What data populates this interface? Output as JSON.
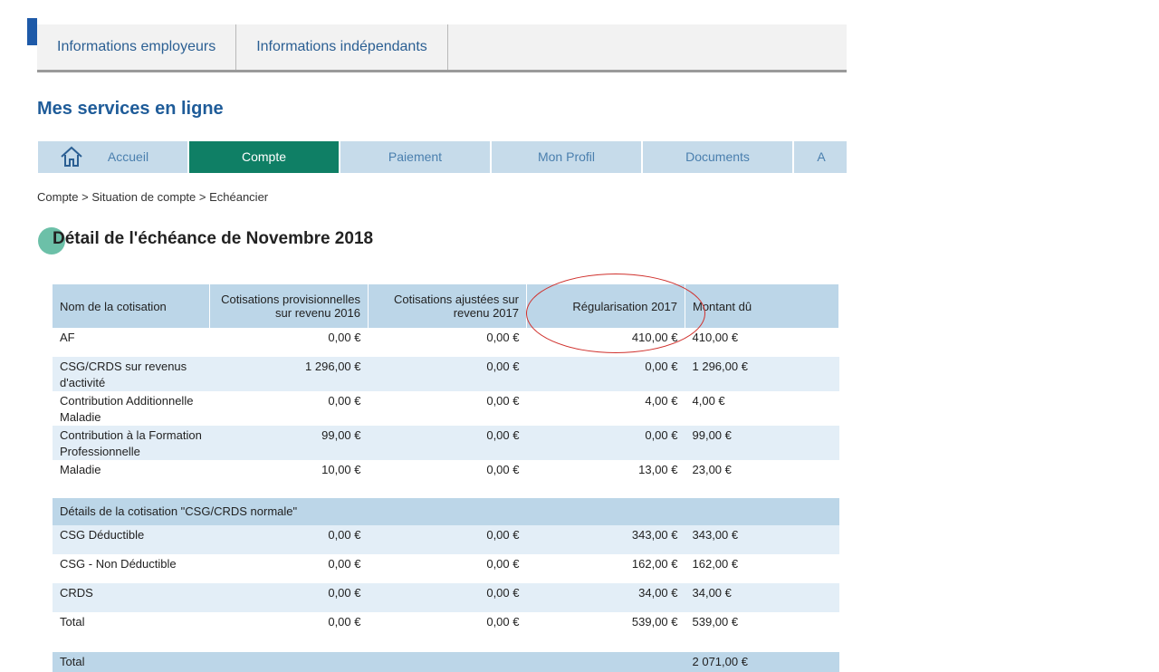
{
  "top_tabs": [
    "Informations employeurs",
    "Informations indépendants"
  ],
  "heading": "Mes services en ligne",
  "nav": {
    "items": [
      "Accueil",
      "Compte",
      "Paiement",
      "Mon Profil",
      "Documents",
      "A"
    ],
    "active": "Compte",
    "home_icon": "home-icon"
  },
  "breadcrumb": {
    "parts": [
      "Compte",
      "Situation de compte",
      "Echéancier"
    ],
    "separator": " > "
  },
  "section_title": "Détail de l'échéance de Novembre 2018",
  "table": {
    "headers": [
      "Nom de la cotisation",
      "Cotisations provisionnelles sur revenu 2016",
      "Cotisations ajustées sur revenu 2017",
      "Régularisation 2017",
      "Montant dû"
    ],
    "rows": [
      [
        "AF",
        "0,00 €",
        "0,00 €",
        "410,00 €",
        "410,00 €"
      ],
      [
        "CSG/CRDS sur revenus d'activité",
        "1 296,00 €",
        "0,00 €",
        "0,00 €",
        "1 296,00 €"
      ],
      [
        "Contribution Additionnelle Maladie",
        "0,00 €",
        "0,00 €",
        "4,00 €",
        "4,00 €"
      ],
      [
        "Contribution à la Formation Professionnelle",
        "99,00 €",
        "0,00 €",
        "0,00 €",
        "99,00 €"
      ],
      [
        "Maladie",
        "10,00 €",
        "0,00 €",
        "13,00 €",
        "23,00 €"
      ]
    ],
    "sub_header": "Détails de la cotisation \"CSG/CRDS normale\"",
    "sub_rows": [
      [
        "CSG Déductible",
        "0,00 €",
        "0,00 €",
        "343,00 €",
        "343,00 €"
      ],
      [
        "CSG - Non Déductible",
        "0,00 €",
        "0,00 €",
        "162,00 €",
        "162,00 €"
      ],
      [
        "CRDS",
        "0,00 €",
        "0,00 €",
        "34,00 €",
        "34,00 €"
      ],
      [
        "Total",
        "0,00 €",
        "0,00 €",
        "539,00 €",
        "539,00 €"
      ]
    ],
    "final_total": [
      "Total",
      "",
      "",
      "",
      "2 071,00 €"
    ]
  },
  "colors": {
    "accent_blue": "#1f5c99",
    "active_green": "#0f7f65",
    "nav_blue": "#c6dbea",
    "table_header": "#bcd6e8",
    "row_alt": "#e3eef7",
    "annotation_red": "#d0312d"
  }
}
